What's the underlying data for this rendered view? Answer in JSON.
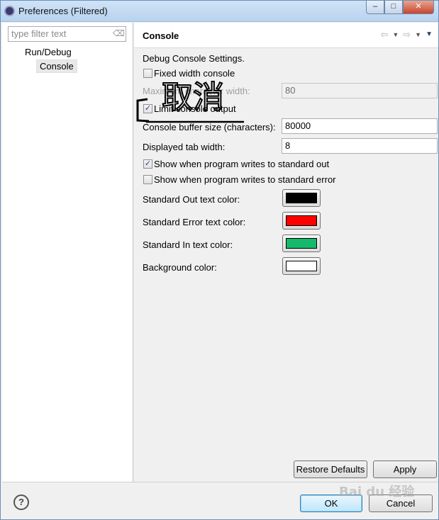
{
  "window": {
    "title": "Preferences (Filtered)",
    "controls": {
      "minimize": "–",
      "maximize": "□",
      "close": "✕"
    }
  },
  "sidebar": {
    "filter_placeholder": "type filter text",
    "tree": [
      {
        "label": "Run/Debug"
      },
      {
        "label": "Console",
        "selected": true
      }
    ]
  },
  "page": {
    "title": "Console",
    "nav_icons": [
      "back-arrow-icon",
      "dropdown-icon",
      "forward-arrow-icon",
      "dropdown-icon",
      "view-menu-icon"
    ],
    "section_label": "Debug Console Settings.",
    "fixed_width": {
      "label": "Fixed width console",
      "checked": false
    },
    "max_width": {
      "label": "Maximum character width:",
      "value": "80",
      "enabled": false
    },
    "limit_output": {
      "label": "Limit console output",
      "checked": true
    },
    "buffer_size": {
      "label": "Console buffer size (characters):",
      "value": "80000"
    },
    "tab_width": {
      "label": "Displayed tab width:",
      "value": "8"
    },
    "show_stdout": {
      "label": "Show when program writes to standard out",
      "checked": true
    },
    "show_stderr": {
      "label": "Show when program writes to standard error",
      "checked": false
    },
    "colors": [
      {
        "label": "Standard Out text color:",
        "color": "#000000"
      },
      {
        "label": "Standard Error text color:",
        "color": "#ff0000"
      },
      {
        "label": "Standard In text color:",
        "color": "#16b96b"
      },
      {
        "label": "Background color:",
        "color": "#ffffff"
      }
    ],
    "restore_defaults": "Restore Defaults",
    "apply": "Apply"
  },
  "footer": {
    "ok": "OK",
    "cancel": "Cancel"
  },
  "annotation": {
    "handwritten_text": "取消",
    "watermark": "Bai du 经验"
  }
}
